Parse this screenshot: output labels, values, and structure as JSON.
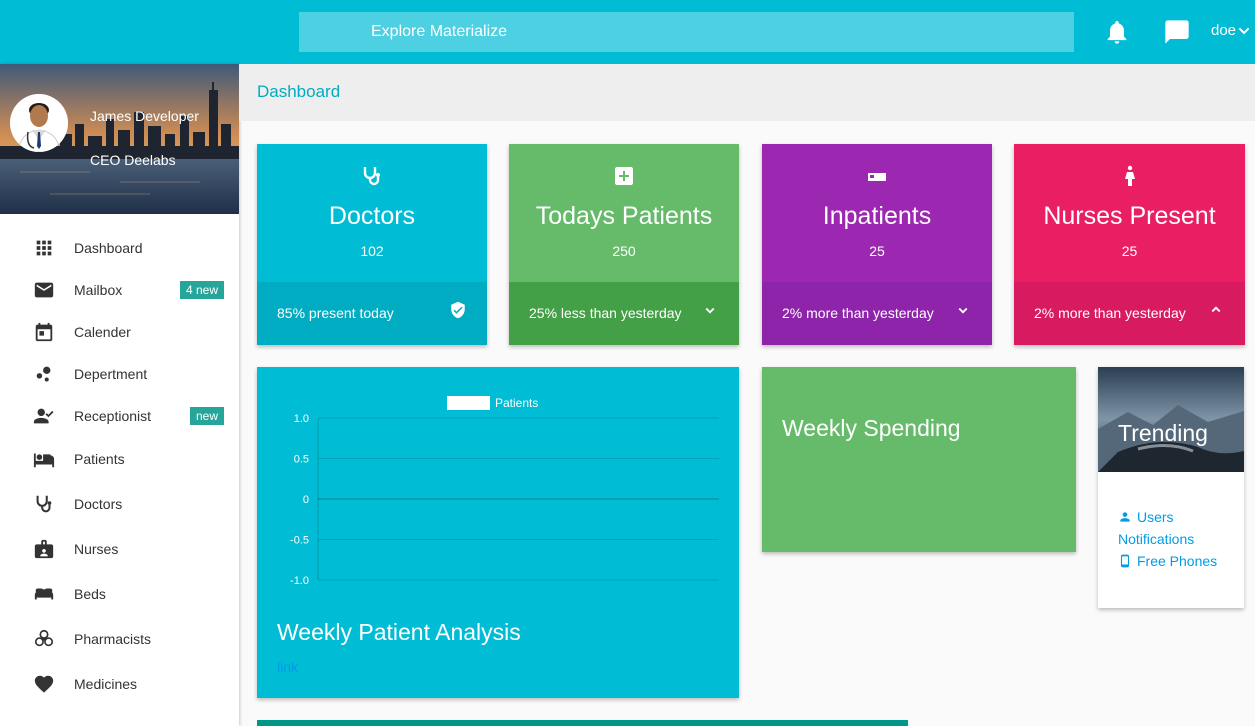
{
  "navbar": {
    "search_label": "Explore Materialize",
    "user_label": "doe",
    "colors": {
      "bar": "#00bcd4",
      "search": "#4dd0e1"
    },
    "icons": [
      "bell-icon",
      "chat-icon",
      "chevron-down-icon"
    ]
  },
  "profile": {
    "name": "James Developer",
    "role": "CEO Deelabs"
  },
  "sidebar": {
    "items": [
      {
        "label": "Dashboard",
        "icon": "grid-icon"
      },
      {
        "label": "Mailbox",
        "icon": "mail-icon",
        "badge": "4 new"
      },
      {
        "label": "Calender",
        "icon": "calendar-icon"
      },
      {
        "label": "Depertment",
        "icon": "bubbles-icon"
      },
      {
        "label": "Receptionist",
        "icon": "person-check-icon",
        "badge": "new"
      },
      {
        "label": "Patients",
        "icon": "hotel-icon"
      },
      {
        "label": "Doctors",
        "icon": "stethoscope-icon"
      },
      {
        "label": "Nurses",
        "icon": "badge-icon"
      },
      {
        "label": "Beds",
        "icon": "bed-icon"
      },
      {
        "label": "Pharmacists",
        "icon": "biohazard-icon"
      },
      {
        "label": "Medicines",
        "icon": "heart-icon"
      }
    ]
  },
  "breadcrumb": {
    "title": "Dashboard"
  },
  "stats": [
    {
      "title": "Doctors",
      "value": "102",
      "footer": "85% present today",
      "icon": "stethoscope-icon",
      "footer_icon": "shield-check-icon",
      "color": "#00bcd4",
      "footer_color": "#00acc1"
    },
    {
      "title": "Todays Patients",
      "value": "250",
      "footer": "25% less than yesterday",
      "icon": "plus-box-icon",
      "footer_icon": "chevron-down-icon",
      "color": "#66bb6a",
      "footer_color": "#43a047"
    },
    {
      "title": "Inpatients",
      "value": "25",
      "footer": "2% more than yesterday",
      "icon": "hotel-icon",
      "footer_icon": "chevron-down-icon",
      "color": "#9c27b0",
      "footer_color": "#8e24aa"
    },
    {
      "title": "Nurses Present",
      "value": "25",
      "footer": "2% more than yesterday",
      "icon": "woman-icon",
      "footer_icon": "chevron-up-icon",
      "color": "#e91e63",
      "footer_color": "#d81b60"
    }
  ],
  "chart_card": {
    "title": "Weekly Patient Analysis",
    "link": "link"
  },
  "chart_data": {
    "type": "line",
    "title": "",
    "xlabel": "",
    "ylabel": "",
    "series": [
      {
        "name": "Patients",
        "values": []
      }
    ],
    "y_ticks": [
      "1.0",
      "0.5",
      "0",
      "-0.5",
      "-1.0"
    ],
    "ylim": [
      -1.0,
      1.0
    ],
    "grid": true,
    "legend": "top"
  },
  "spending": {
    "title": "Weekly Spending"
  },
  "trending": {
    "title": "Trending",
    "links": [
      {
        "label": "Users",
        "icon": "person-icon"
      },
      {
        "label": "Notifications",
        "icon": ""
      },
      {
        "label": "Free Phones",
        "icon": "phone-icon"
      }
    ]
  }
}
